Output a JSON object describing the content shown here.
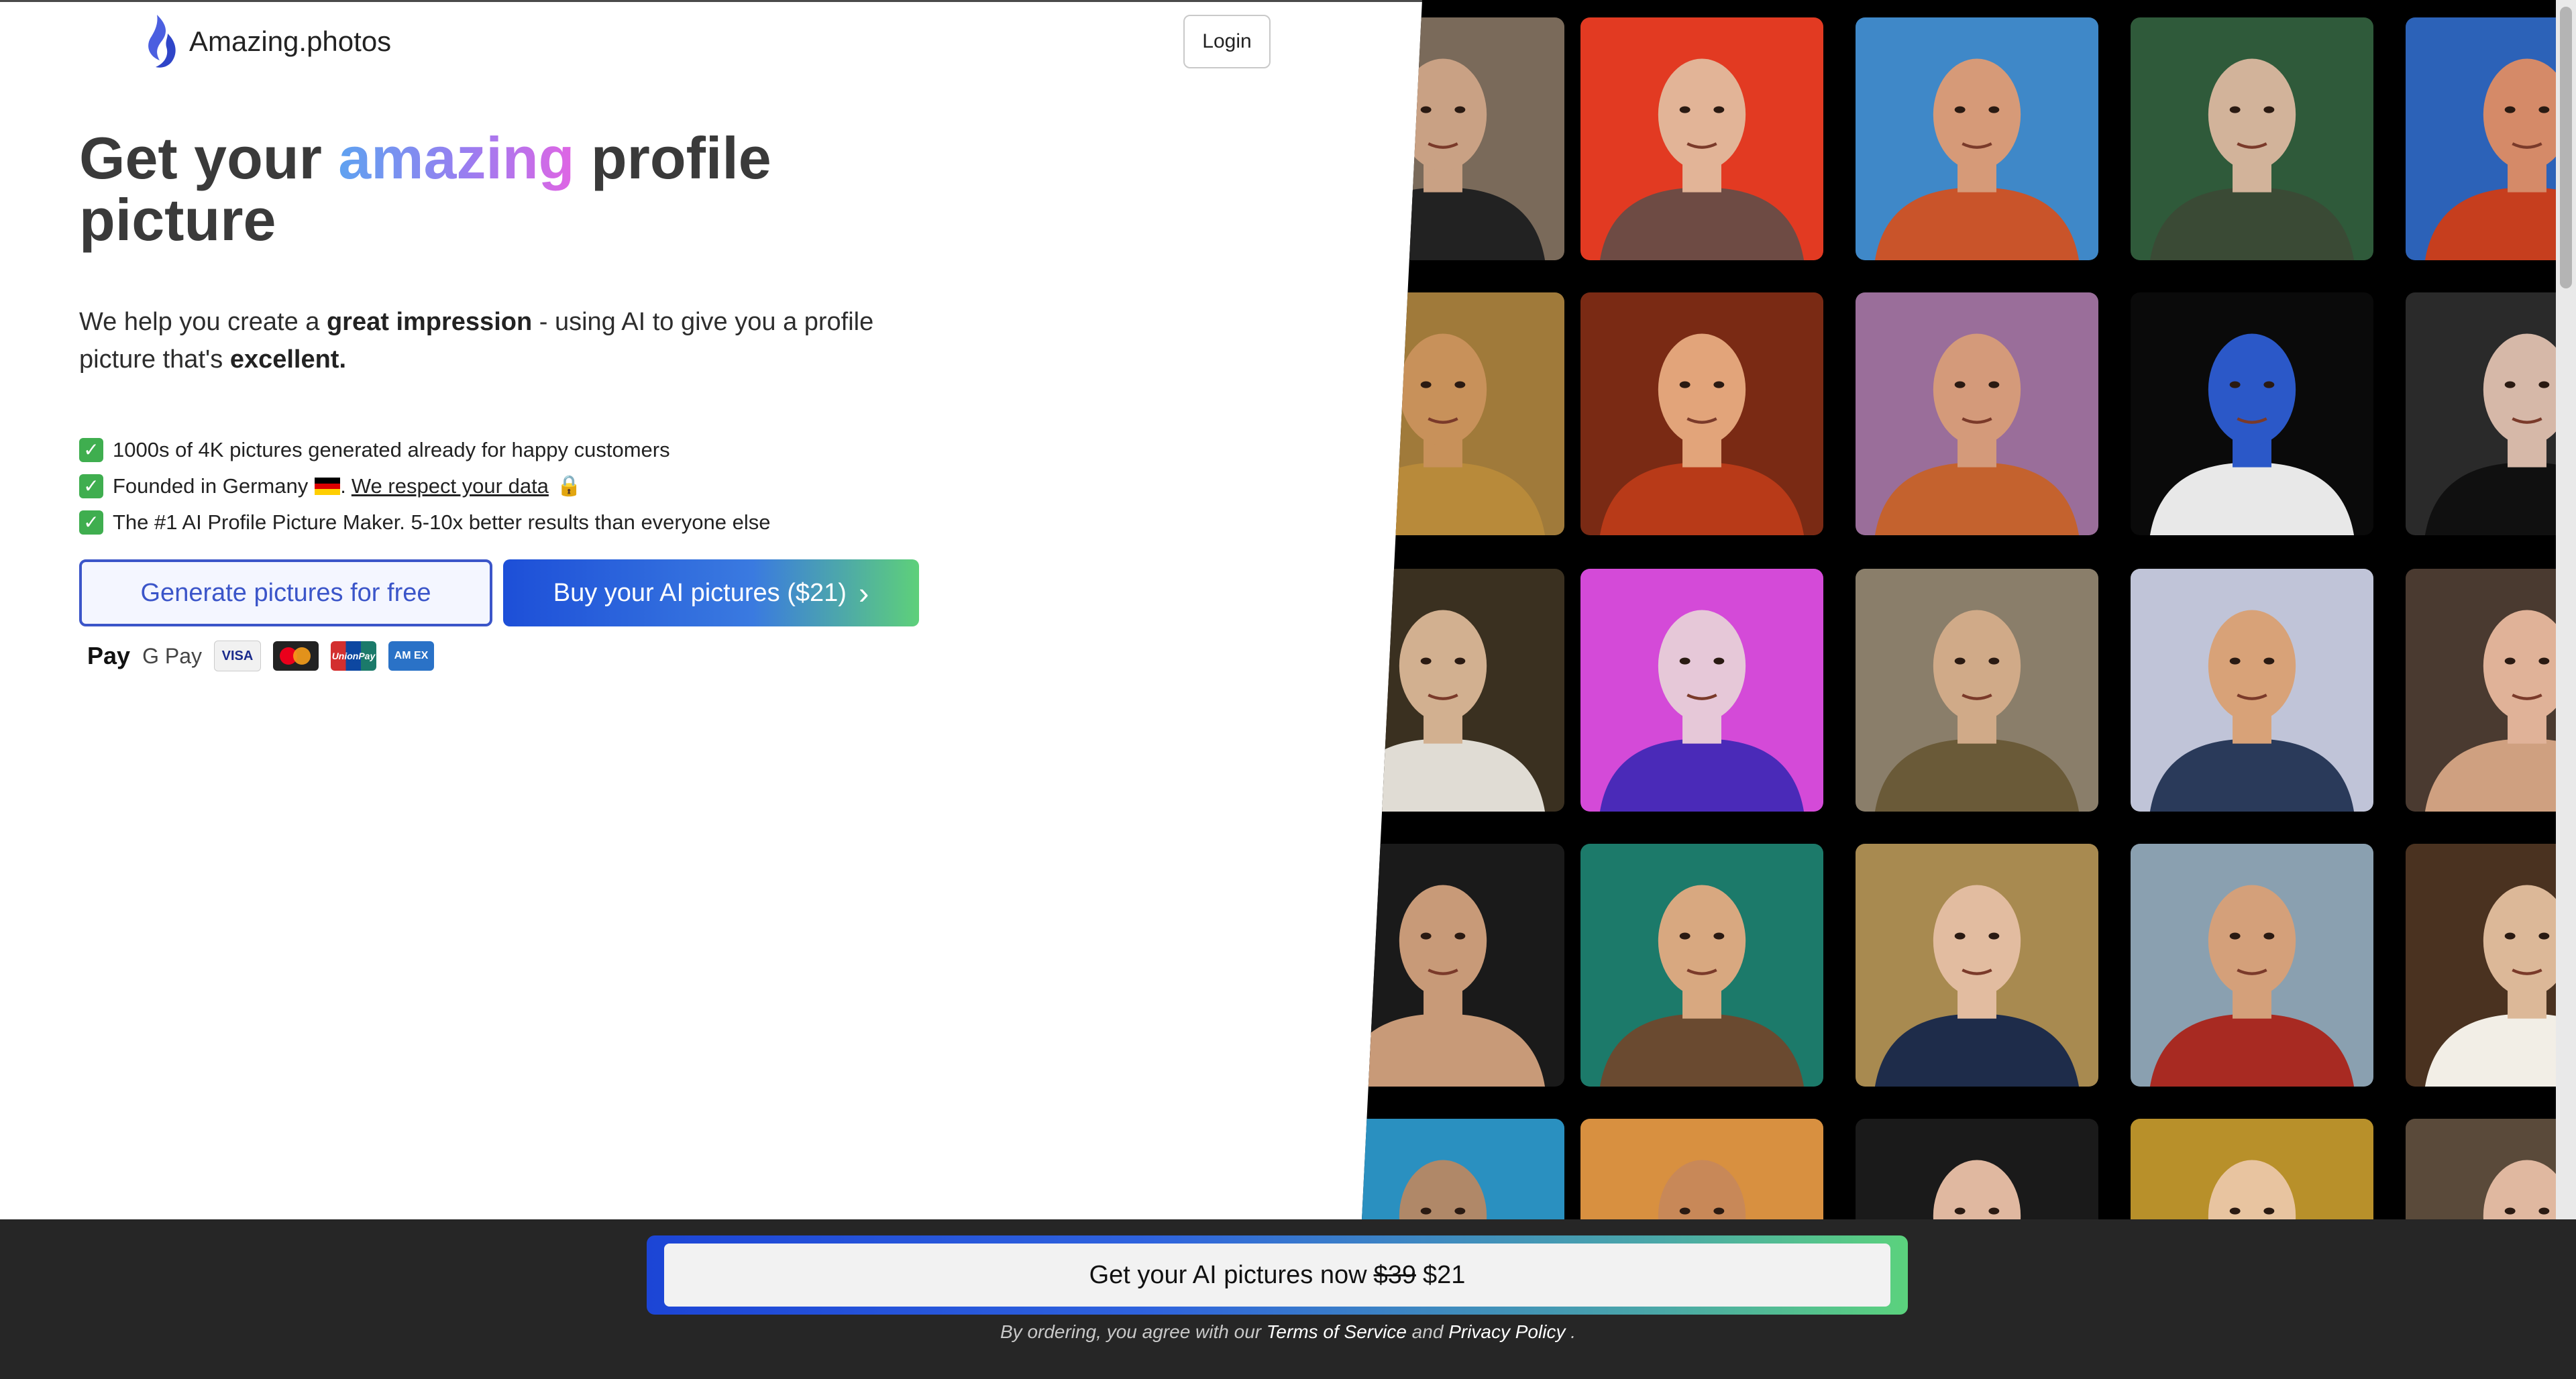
{
  "header": {
    "brand": "Amazing.photos",
    "login_label": "Login"
  },
  "hero": {
    "title_prefix": "Get your ",
    "title_highlight": "amazing",
    "title_suffix": " profile picture",
    "sub_1": "We help you create a ",
    "sub_bold_1": "great impression",
    "sub_2": " - using AI to give you a profile picture that's ",
    "sub_bold_2": "excellent."
  },
  "features": [
    {
      "text": "1000s of 4K pictures generated already for happy customers"
    },
    {
      "text": "Founded in Germany",
      "link": "We respect your data"
    },
    {
      "text": "The #1 AI Profile Picture Maker. 5-10x better results than everyone else"
    }
  ],
  "buttons": {
    "free": "Generate pictures for free",
    "buy": "Buy your AI pictures ($21)"
  },
  "payments": {
    "apple": "Pay",
    "google": "G Pay",
    "visa": "VISA",
    "unionpay": "UnionPay",
    "amex": "AM EX"
  },
  "bottom_cta": {
    "label": "Get your AI pictures now",
    "old_price": "$39",
    "new_price": "$21"
  },
  "legal": {
    "prefix": "By ordering, you agree with our ",
    "terms": "Terms of Service",
    "and": " and ",
    "privacy": "Privacy Policy",
    "suffix": " ."
  },
  "colors": {
    "accent_blue": "#1d4fd8",
    "accent_green": "#5ed07a",
    "check_green": "#3fae4f",
    "bottom_bar": "#262626"
  },
  "gallery": [
    {
      "bg": "#7a6a5a",
      "skin": "#c9a184",
      "shirt": "#222"
    },
    {
      "bg": "#e23a22",
      "skin": "#e2b497",
      "shirt": "#6e4b44"
    },
    {
      "bg": "#3f88c8",
      "skin": "#d69a78",
      "shirt": "#c9542a"
    },
    {
      "bg": "#2f5a3a",
      "skin": "#d2b39a",
      "shirt": "#3a4a35"
    },
    {
      "bg": "#2c62b8",
      "skin": "#d58a68",
      "shirt": "#c63e1e"
    },
    {
      "bg": "#a07a3a",
      "skin": "#c8915a",
      "shirt": "#b88a3a"
    },
    {
      "bg": "#7a2a14",
      "skin": "#e2a47a",
      "shirt": "#b83a18"
    },
    {
      "bg": "#9a6e9a",
      "skin": "#d49a7a",
      "shirt": "#c4622e"
    },
    {
      "bg": "#0a0a0a",
      "skin": "#2b58c8",
      "shirt": "#e8e8e8"
    },
    {
      "bg": "#2a2a2a",
      "skin": "#d6b8a8",
      "shirt": "#101010"
    },
    {
      "bg": "#3a3020",
      "skin": "#d2b090",
      "shirt": "#e0dcd4"
    },
    {
      "bg": "#d44ad8",
      "skin": "#e6c8d8",
      "shirt": "#4a2ab8"
    },
    {
      "bg": "#8a7e6a",
      "skin": "#d0aa88",
      "shirt": "#6a5a38"
    },
    {
      "bg": "#c0c4d8",
      "skin": "#d8a278",
      "shirt": "#2a3a5a"
    },
    {
      "bg": "#4a3a30",
      "skin": "#e0b298",
      "shirt": "#cfa080"
    },
    {
      "bg": "#1a1a1a",
      "skin": "#c89a78",
      "shirt": "#c89a78"
    },
    {
      "bg": "#1c7a6a",
      "skin": "#d8a880",
      "shirt": "#6a4a30"
    },
    {
      "bg": "#a88a50",
      "skin": "#e2bca0",
      "shirt": "#1e2c4a"
    },
    {
      "bg": "#8aa0b0",
      "skin": "#d4a07a",
      "shirt": "#a82a22"
    },
    {
      "bg": "#4a3220",
      "skin": "#dcb898",
      "shirt": "#f2eee6"
    },
    {
      "bg": "#2a90c0",
      "skin": "#b08868",
      "shirt": "#222"
    },
    {
      "bg": "#d89040",
      "skin": "#c88858",
      "shirt": "#6a3a18"
    },
    {
      "bg": "#1a1a1a",
      "skin": "#e0b8a0",
      "shirt": "#2a2a2a"
    },
    {
      "bg": "#b8902a",
      "skin": "#e8c4a0",
      "shirt": "#2a4a8a"
    },
    {
      "bg": "#5a4a3a",
      "skin": "#e0b8a0",
      "shirt": "#2a2a2a"
    }
  ]
}
